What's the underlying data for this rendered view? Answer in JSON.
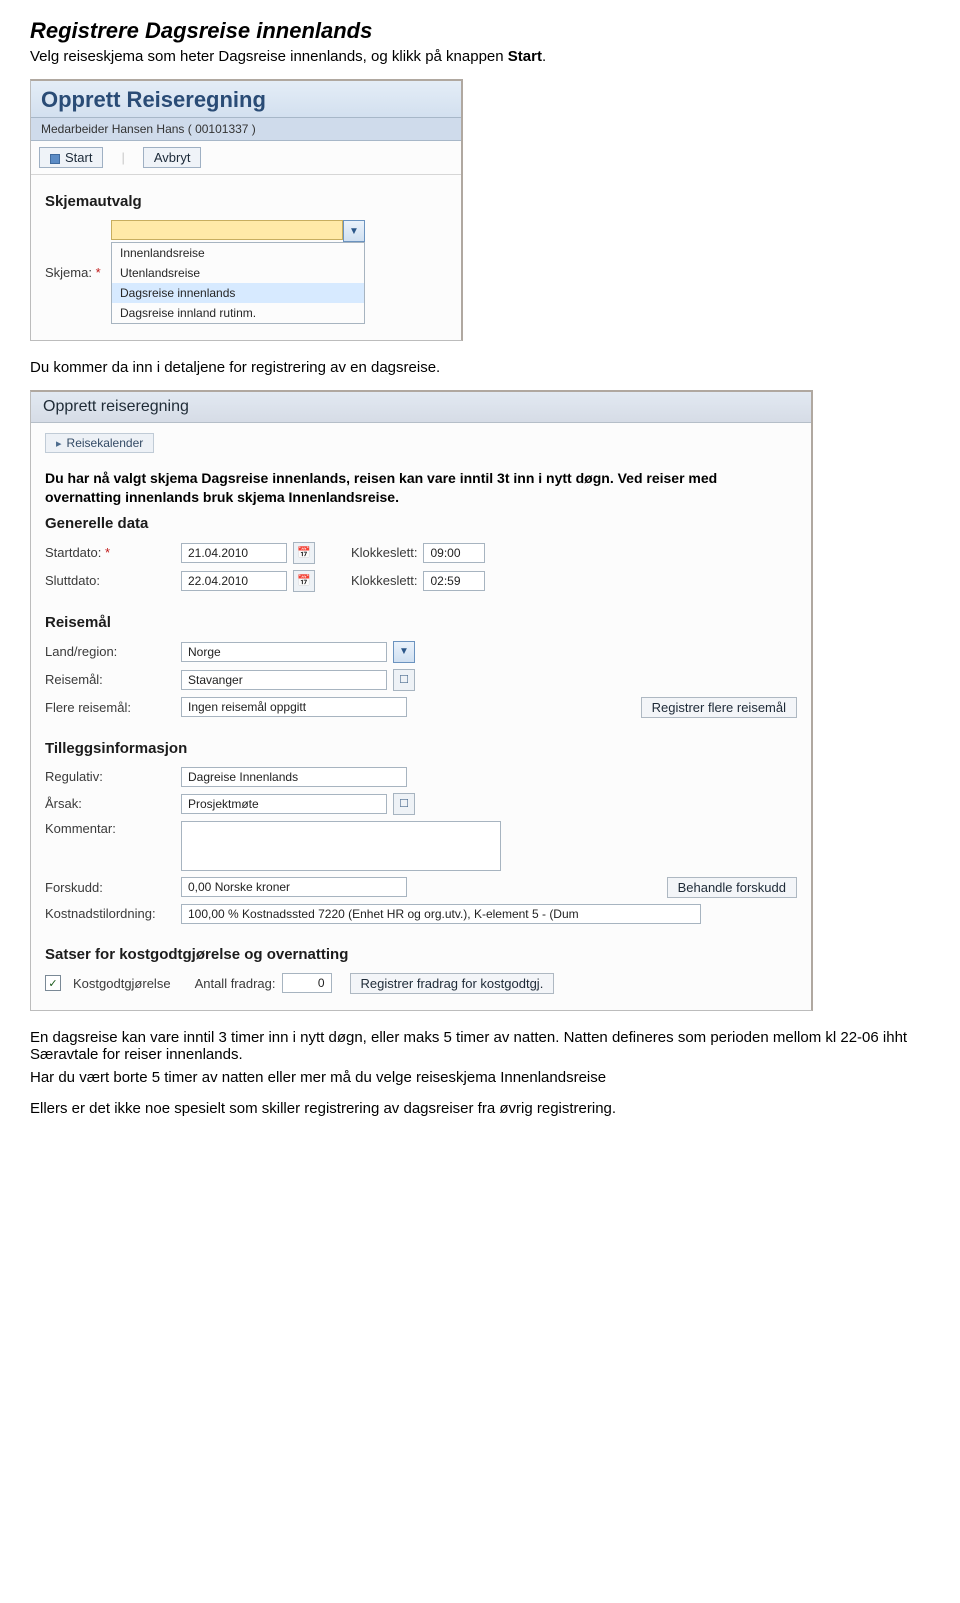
{
  "doc": {
    "title": "Registrere Dagsreise innenlands",
    "intro_pre": "Velg reiseskjema som heter Dagsreise innenlands, og klikk på knappen ",
    "intro_bold": "Start",
    "intro_post": ".",
    "mid": "Du kommer da inn i detaljene for registrering av en dagsreise.",
    "outro1": "En dagsreise kan vare inntil 3 timer inn i nytt døgn, eller maks 5 timer av natten. Natten defineres som perioden mellom kl 22-06 ihht Særavtale for reiser innenlands.",
    "outro2": "Har du vært borte 5 timer av natten eller mer må du velge reiseskjema Innenlandsreise",
    "outro3": "Ellers er det ikke noe spesielt som skiller registrering av dagsreiser fra øvrig registrering."
  },
  "panel1": {
    "title": "Opprett Reiseregning",
    "subbar": "Medarbeider Hansen Hans ( 00101337 )",
    "btn_start": "Start",
    "btn_cancel": "Avbryt",
    "section_title": "Skjemautvalg",
    "label_skjema": "Skjema:",
    "options": [
      "Innenlandsreise",
      "Utenlandsreise",
      "Dagsreise innenlands",
      "Dagsreise innland rutinm."
    ],
    "selected_index": 2
  },
  "panel2": {
    "title": "Opprett reiseregning",
    "link_cal": "Reisekalender",
    "instr": "Du har nå valgt skjema Dagsreise innenlands, reisen kan vare inntil 3t inn i nytt døgn. Ved reiser med overnatting innenlands bruk skjema Innenlandsreise.",
    "sec_general": "Generelle data",
    "lbl_startdato": "Startdato:",
    "val_startdato": "21.04.2010",
    "lbl_klokke": "Klokkeslett:",
    "val_starttid": "09:00",
    "lbl_sluttdato": "Sluttdato:",
    "val_sluttdato": "22.04.2010",
    "val_slutttid": "02:59",
    "sec_dest": "Reisemål",
    "lbl_land": "Land/region:",
    "val_land": "Norge",
    "lbl_reisemal": "Reisemål:",
    "val_reisemal": "Stavanger",
    "lbl_flere": "Flere reisemål:",
    "val_flere": "Ingen reisemål oppgitt",
    "btn_flere": "Registrer flere reisemål",
    "sec_tillegg": "Tilleggsinformasjon",
    "lbl_regulativ": "Regulativ:",
    "val_regulativ": "Dagreise Innenlands",
    "lbl_arsak": "Årsak:",
    "val_arsak": "Prosjektmøte",
    "lbl_kommentar": "Kommentar:",
    "val_kommentar": "",
    "lbl_forskudd": "Forskudd:",
    "val_forskudd": "0,00 Norske kroner",
    "btn_forskudd": "Behandle forskudd",
    "lbl_kost": "Kostnadstilordning:",
    "val_kost": "100,00 % Kostnadssted 7220 (Enhet HR og org.utv.), K-element 5 - (Dum",
    "sec_satser": "Satser for kostgodtgjørelse og overnatting",
    "lbl_kostgodt": "Kostgodtgjørelse",
    "lbl_antall": "Antall fradrag:",
    "val_antall": "0",
    "btn_fradrag": "Registrer fradrag for kostgodtgj.",
    "checked": true
  }
}
